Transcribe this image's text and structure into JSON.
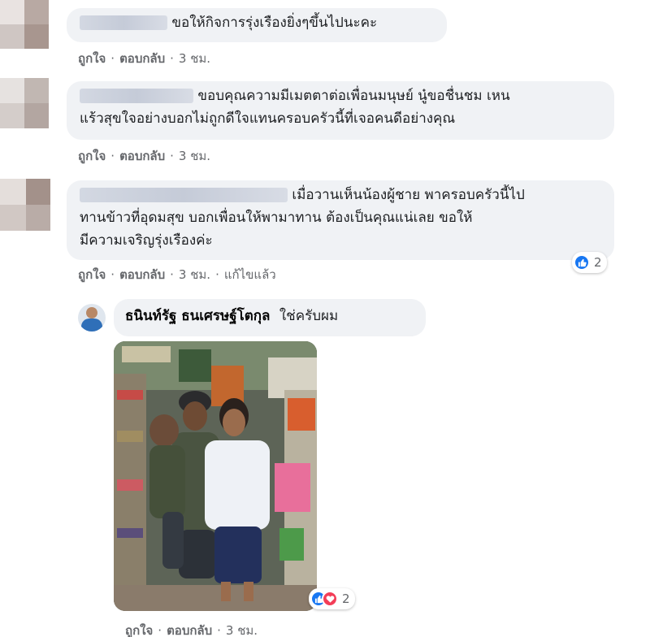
{
  "comments": [
    {
      "text": "ขอให้กิจการรุ่งเรืองยิ่งๆขึ้นไปนะคะ",
      "actions": {
        "like": "ถูกใจ",
        "reply": "ตอบกลับ",
        "time": "3 ชม."
      }
    },
    {
      "line1": "ขอบคุณความมีเมตตาต่อเพื่อนมนุษย์ นู๋ขอชื่นชม เหน",
      "line2": "แร้วสุขใจอย่างบอกไม่ถูกดีใจแทนครอบครัวนี้ที่เจอคนดีอย่างคุณ",
      "actions": {
        "like": "ถูกใจ",
        "reply": "ตอบกลับ",
        "time": "3 ชม."
      }
    },
    {
      "line1": "เมื่อวานเห็นน้องผู้ชาย พาครอบครัวนี้ไป",
      "line2": "ทานข้าวที่อุดมสุข บอกเพื่อนให้พามาทาน ต้องเป็นคุณแน่เลย ขอให้",
      "line3": "มีความเจริญรุ่งเรืองค่ะ",
      "reaction_count": "2",
      "actions": {
        "like": "ถูกใจ",
        "reply": "ตอบกลับ",
        "time": "3 ชม.",
        "edited": "แก้ไขแล้ว"
      }
    }
  ],
  "reply": {
    "author": "ธนินท์รัฐ ธนเศรษฐ์โตกุล",
    "text": "ใช่ครับผม",
    "reaction_count": "2",
    "actions": {
      "like": "ถูกใจ",
      "reply": "ตอบกลับ",
      "time": "3 ชม."
    }
  },
  "colors": {
    "bubble": "#f0f2f5",
    "meta": "#65676b",
    "like": "#1877f2",
    "love": "#f33e58"
  }
}
